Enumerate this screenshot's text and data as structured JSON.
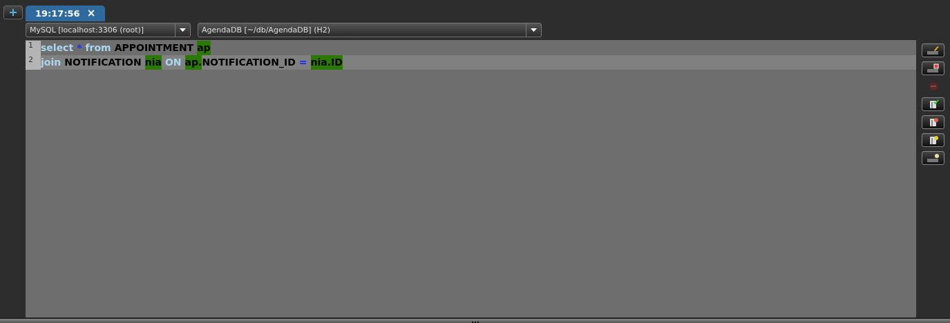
{
  "tabs": [
    {
      "label": "19:17:56",
      "close": "×",
      "selected": true
    }
  ],
  "connection": {
    "value": "MySQL [localhost:3306 (root)]"
  },
  "database": {
    "value": "AgendaDB [~/db/AgendaDB] (H2)"
  },
  "editor": {
    "lines": [
      {
        "number": "1",
        "current": false,
        "tokens": [
          {
            "text": "select",
            "kind": "keyword",
            "marked": false
          },
          {
            "text": "*",
            "kind": "operator",
            "marked": false
          },
          {
            "text": "from",
            "kind": "keyword",
            "marked": false
          },
          {
            "text": "APPOINTMENT",
            "kind": "plain",
            "marked": false
          },
          {
            "text": "ap",
            "kind": "plain",
            "marked": true
          }
        ]
      },
      {
        "number": "2",
        "current": true,
        "tokens": [
          {
            "text": "join",
            "kind": "keyword",
            "marked": false
          },
          {
            "text": "NOTIFICATION",
            "kind": "plain",
            "marked": false
          },
          {
            "text": "nia",
            "kind": "plain",
            "marked": true
          },
          {
            "text": "ON",
            "kind": "keyword",
            "marked": false
          },
          {
            "text": "ap.",
            "kind": "plain",
            "marked": true
          },
          {
            "text": "NOTIFICATION_ID",
            "kind": "plain",
            "marked": false,
            "joined": true
          },
          {
            "text": "=",
            "kind": "operator",
            "marked": false
          },
          {
            "text": "nia.ID",
            "kind": "plain",
            "marked": true
          }
        ]
      }
    ]
  },
  "toolbar": [
    {
      "kind": "run-sql",
      "disabled": false
    },
    {
      "kind": "stop-sql",
      "disabled": false
    },
    {
      "kind": "cancel",
      "disabled": true
    },
    {
      "kind": "commit",
      "disabled": false
    },
    {
      "kind": "rollback",
      "disabled": false
    },
    {
      "kind": "transaction",
      "disabled": false
    },
    {
      "kind": "explain",
      "disabled": false
    }
  ]
}
